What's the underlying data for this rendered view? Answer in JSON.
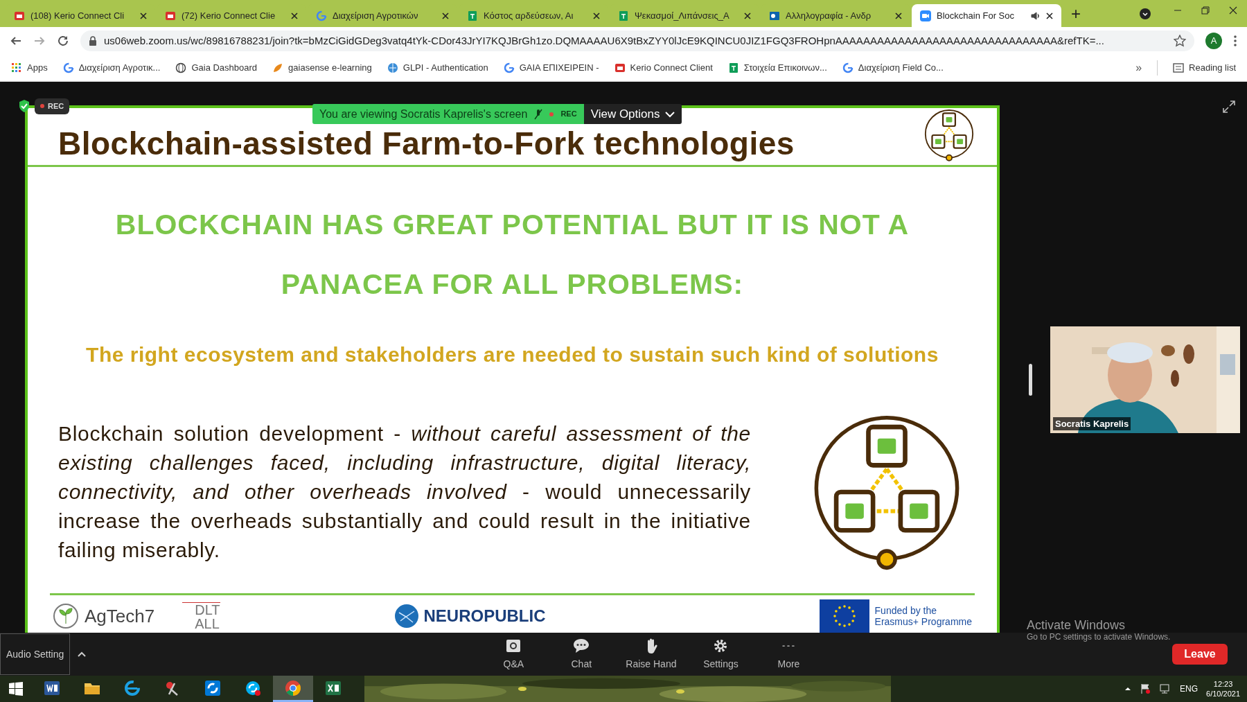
{
  "browser": {
    "tabs": [
      {
        "title": "(108) Kerio Connect Cli",
        "kind": "kerio",
        "selected": false
      },
      {
        "title": "(72) Kerio Connect Clie",
        "kind": "kerio",
        "selected": false
      },
      {
        "title": "Διαχείριση Αγροτικών",
        "kind": "google",
        "selected": false
      },
      {
        "title": "Κόστος αρδεύσεων, Αι",
        "kind": "sheets",
        "selected": false
      },
      {
        "title": "Ψεκασμοί_Λιπάνσεις_Α",
        "kind": "sheets",
        "selected": false
      },
      {
        "title": "Αλληλογραφία - Ανδρ",
        "kind": "outlook",
        "selected": false
      },
      {
        "title": "Blockchain For Soc",
        "kind": "zoom",
        "selected": true
      }
    ],
    "new_tab": "+",
    "url": "us06web.zoom.us/wc/89816788231/join?tk=bMzCiGidGDeg3vatq4tYk-CDor43JrYI7KQJBrGh1zo.DQMAAAAU6X9tBxZYY0lJcE9KQINCU0JIZ1FGQ3FROHpnAAAAAAAAAAAAAAAAAAAAAAAAAAAAAAAA&refTK=...",
    "profile_initial": "A",
    "bookmarks": [
      {
        "label": "Apps",
        "kind": "apps"
      },
      {
        "label": "Διαχείριση Αγροτικ...",
        "kind": "google"
      },
      {
        "label": "Gaia Dashboard",
        "kind": "globe"
      },
      {
        "label": "gaiasense e-learning",
        "kind": "brand"
      },
      {
        "label": "GLPI - Authentication",
        "kind": "web"
      },
      {
        "label": "GAIA ΕΠΙΧΕΙΡΕΙΝ -",
        "kind": "google"
      },
      {
        "label": "Kerio Connect Client",
        "kind": "kerio"
      },
      {
        "label": "Στοιχεία Επικοινων...",
        "kind": "sheets"
      },
      {
        "label": "Διαχείριση Field Co...",
        "kind": "google"
      }
    ],
    "more": "»",
    "reading_list": "Reading list"
  },
  "meeting": {
    "rec_badge": "REC",
    "share_banner": "You are viewing Socratis Kaprelis's screen",
    "banner_rec": "REC",
    "view_options": "View Options",
    "slide": {
      "title": "Blockchain-assisted Farm-to-Fork technologies",
      "heading": "BLOCKCHAIN HAS GREAT POTENTIAL BUT IT IS NOT A PANACEA FOR ALL PROBLEMS:",
      "subtitle": "The right ecosystem and stakeholders are needed to sustain such kind of solutions",
      "paragraph": "Blockchain solution development - *without careful assessment of the existing challenges faced, including infrastructure, digital literacy, connectivity, and other overheads involved* - would unnecessarily increase the overheads substantially and could result in the initiative failing miserably.",
      "footer": {
        "agtech": "AgTech7",
        "dlt": "DLT",
        "dlt_sub": "ALL",
        "neuropublic": "NEUROPUBLIC",
        "funded": "Funded by the",
        "programme": "Erasmus+ Programme"
      }
    },
    "participant": {
      "name": "Socratis Kaprelis"
    },
    "activate": {
      "title": "Activate Windows",
      "hint": "Go to PC settings to activate Windows."
    },
    "toolbar": {
      "audio": "Audio Setting",
      "buttons": [
        {
          "label": "Q&A",
          "kind": "qa"
        },
        {
          "label": "Chat",
          "kind": "chat"
        },
        {
          "label": "Raise Hand",
          "kind": "hand"
        },
        {
          "label": "Settings",
          "kind": "gear"
        },
        {
          "label": "More",
          "kind": "more"
        }
      ],
      "leave": "Leave"
    }
  },
  "taskbar": {
    "apps": [
      {
        "kind": "word",
        "selected": false
      },
      {
        "kind": "folder",
        "selected": false
      },
      {
        "kind": "ie",
        "selected": false
      },
      {
        "kind": "paint",
        "selected": false
      },
      {
        "kind": "sfb",
        "selected": false
      },
      {
        "kind": "skype",
        "selected": false
      },
      {
        "kind": "chrome",
        "selected": true
      },
      {
        "kind": "excel",
        "selected": false
      }
    ],
    "language": "ENG",
    "time": "12:23",
    "date": "6/10/2021"
  }
}
